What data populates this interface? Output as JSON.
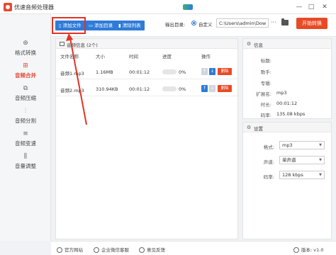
{
  "app": {
    "title": "优速音频处理器"
  },
  "window": {
    "minimize": "—",
    "maximize": "□",
    "close": "✕"
  },
  "sidebar": {
    "items": [
      {
        "label": "格式转换",
        "icon": "⊛"
      },
      {
        "label": "音频合并",
        "icon": "⊞"
      },
      {
        "label": "音频压缩",
        "icon": "⧉"
      },
      {
        "label": "音频分割",
        "icon": "⫶"
      },
      {
        "label": "音频变速",
        "icon": "≡"
      },
      {
        "label": "音量调整",
        "icon": "⫼"
      }
    ],
    "active": "音频合并"
  },
  "toolbar": {
    "add_file": "添加文件",
    "add_folder": "添加目录",
    "clear_list": "清除列表",
    "output_label": "输出目录:",
    "radio_label": "自定义",
    "path_value": "C:\\Users\\admin\\Downl",
    "browse": "···",
    "convert": "开始转换"
  },
  "file_panel": {
    "title": "音频信息 (2个)",
    "headers": {
      "name": "文件名称",
      "size": "大小",
      "time": "时间",
      "progress": "进度",
      "ops": "操作"
    },
    "rows": [
      {
        "name": "音频1.mp3",
        "size": "1.16MB",
        "time": "00:01:12",
        "progress": "0%",
        "up": "↑",
        "down": "↓",
        "delete": "删除"
      },
      {
        "name": "音频2.mp3",
        "size": "310.94KB",
        "time": "00:01:12",
        "progress": "0%",
        "up": "↑",
        "down": "↓",
        "delete": "删除"
      }
    ]
  },
  "info_panel": {
    "title": "信息",
    "fields": [
      {
        "label": "标题:",
        "value": ""
      },
      {
        "label": "歌手:",
        "value": ""
      },
      {
        "label": "专辑:",
        "value": ""
      },
      {
        "label": "扩展名:",
        "value": "mp3"
      },
      {
        "label": "时长:",
        "value": "00:01:12"
      },
      {
        "label": "码率:",
        "value": "135.08 kbps"
      }
    ]
  },
  "settings_panel": {
    "title": "设置",
    "fields": [
      {
        "label": "格式:",
        "value": "mp3"
      },
      {
        "label": "声道:",
        "value": "单声道"
      },
      {
        "label": "码率:",
        "value": "128 kbps"
      }
    ]
  },
  "footer": {
    "website": "官方网站",
    "wechat": "企业微信客服",
    "feedback": "意见反馈",
    "version_label": "版本:",
    "version": "v1.0"
  },
  "colors": {
    "accent_blue": "#2f7bd8",
    "accent_red": "#e84a26",
    "highlight": "#e53222"
  }
}
